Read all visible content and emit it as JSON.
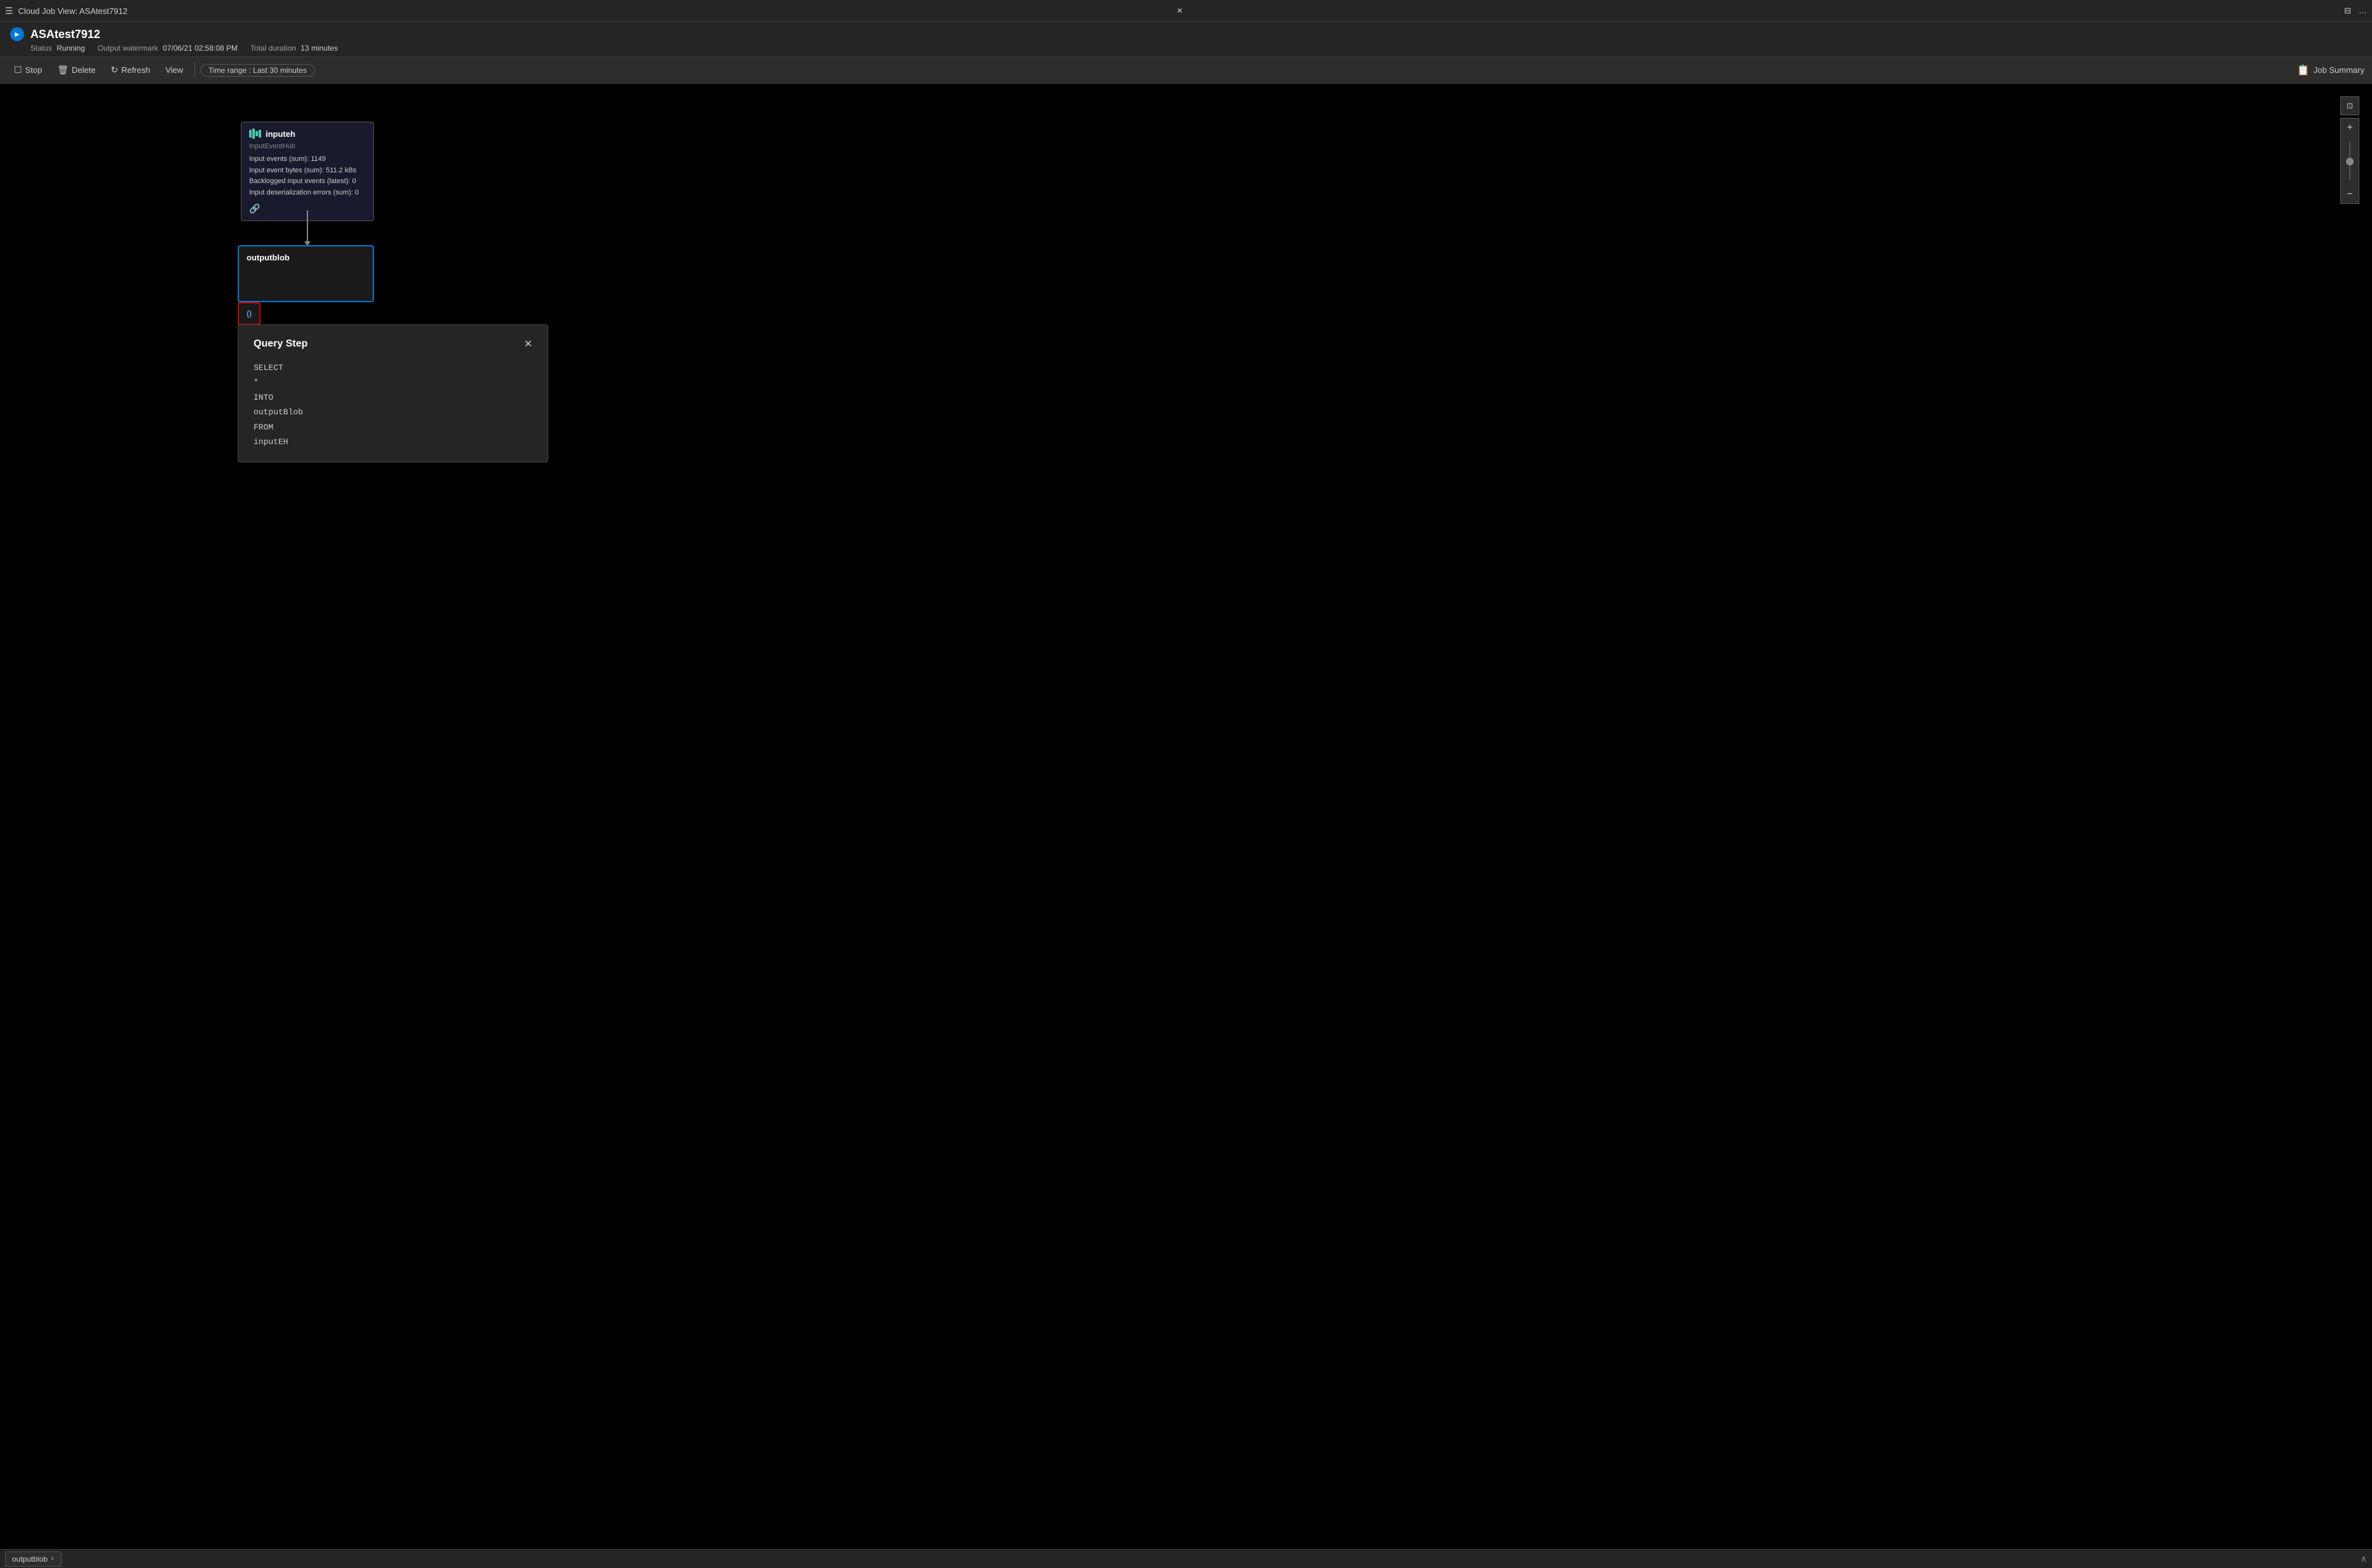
{
  "titleBar": {
    "menuIcon": "☰",
    "title": "Cloud Job View: ASAtest7912",
    "closeIcon": "✕",
    "rightIcons": [
      "⊟",
      "…"
    ]
  },
  "jobHeader": {
    "iconLabel": "►",
    "title": "ASAtest7912",
    "meta": [
      {
        "label": "Status",
        "value": "Running"
      },
      {
        "label": "Output watermark",
        "value": "07/06/21 02:58:08 PM"
      },
      {
        "label": "Total duration",
        "value": "13 minutes"
      }
    ]
  },
  "toolbar": {
    "stopLabel": "Stop",
    "deleteLabel": "Delete",
    "refreshLabel": "Refresh",
    "viewLabel": "View",
    "timeRange": "Time range :  Last 30 minutes",
    "jobSummaryLabel": "Job Summary"
  },
  "diagram": {
    "inputNode": {
      "title": "inputeh",
      "subtitle": "InputEventHub",
      "stats": [
        "Input events (sum): 1149",
        "Input event bytes (sum): 511.2 kBs",
        "Backlogged input events (latest): 0",
        "Input deserialization errors (sum): 0"
      ]
    },
    "outputNode": {
      "title": "outputblob"
    },
    "queryStepIcon": "()"
  },
  "queryStep": {
    "title": "Query Step",
    "code": [
      "SELECT",
      "*",
      "INTO",
      "outputBlob",
      "FROM",
      "inputEH"
    ],
    "closeIcon": "✕"
  },
  "zoomControls": {
    "fitIcon": "⊡",
    "plusIcon": "+",
    "minusIcon": "−"
  },
  "bottomTab": {
    "label": "outputblob",
    "chevronDown": "∨",
    "chevronUp": "∧"
  }
}
